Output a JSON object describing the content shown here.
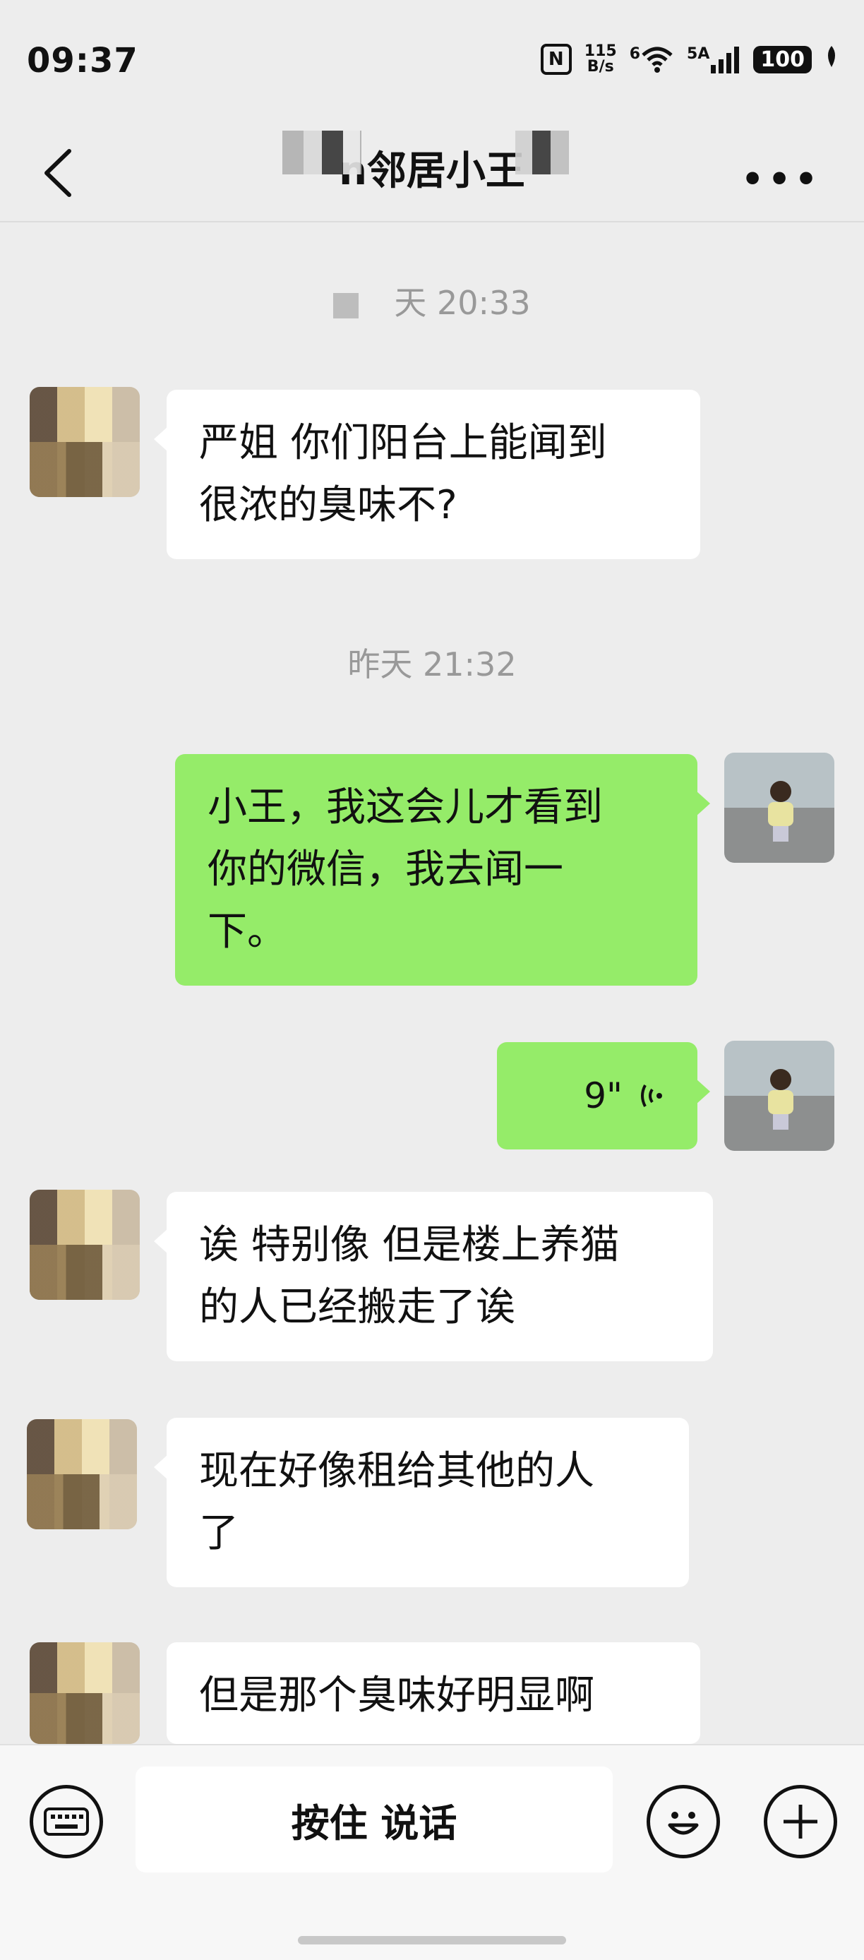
{
  "status_bar": {
    "time": "09:37",
    "nfc": "N",
    "speed_value": "115",
    "speed_unit": "B/s",
    "wifi_label": "6",
    "signal_label": "5A",
    "battery": "100"
  },
  "header": {
    "title": "n邻居小王",
    "more": "•••"
  },
  "messages": {
    "timestamp_1": "天 20:33",
    "m1": "严姐 你们阳台上能闻到\n很浓的臭味不?",
    "timestamp_2": "昨天 21:32",
    "m2": "小王，我这会儿才看到\n你的微信，我去闻一\n下。",
    "m3_duration": "9\"",
    "m4": "诶 特别像 但是楼上养猫\n的人已经搬走了诶",
    "m5": "现在好像租给其他的人\n了",
    "m6": "但是那个臭味好明显啊"
  },
  "input_bar": {
    "talk_label": "按住 说话"
  },
  "icons": {
    "back": "chevron-left-icon",
    "more": "more-icon",
    "voice": "voice-wave-icon",
    "keyboard": "keyboard-icon",
    "emoji": "emoji-icon",
    "plus": "plus-icon"
  },
  "colors": {
    "background": "#ededed",
    "outgoing_bubble": "#95ec69",
    "incoming_bubble": "#ffffff",
    "timestamp": "#999999"
  }
}
